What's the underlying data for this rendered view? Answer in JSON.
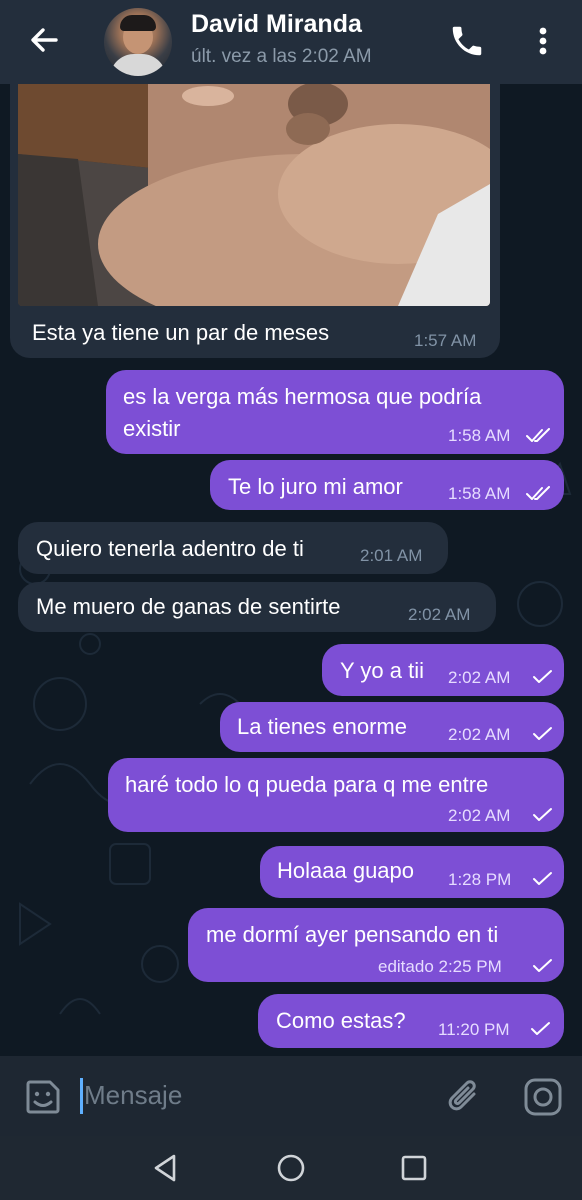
{
  "header": {
    "contact_name": "David Miranda",
    "last_seen": "últ. vez a las 2:02 AM",
    "icons": [
      "back-arrow-icon",
      "phone-icon",
      "more-vert-icon"
    ]
  },
  "messages": [
    {
      "direction": "in",
      "kind": "photo",
      "text": "Esta ya tiene un par de meses",
      "time": "1:57 AM"
    },
    {
      "direction": "out",
      "text": "es la verga más hermosa que podría",
      "text2": "existir",
      "time": "1:58 AM",
      "ticks": "read"
    },
    {
      "direction": "out",
      "text": "Te lo juro mi amor",
      "time": "1:58 AM",
      "ticks": "read"
    },
    {
      "direction": "in",
      "text": "Quiero tenerla adentro de ti",
      "time": "2:01 AM"
    },
    {
      "direction": "in",
      "text": "Me muero de ganas de sentirte",
      "time": "2:02 AM"
    },
    {
      "direction": "out",
      "text": "Y yo a tii",
      "time": "2:02 AM",
      "ticks": "sent"
    },
    {
      "direction": "out",
      "text": "La tienes enorme",
      "time": "2:02 AM",
      "ticks": "sent"
    },
    {
      "direction": "out",
      "text": "haré todo lo q pueda para q me entre",
      "time": "2:02 AM",
      "ticks": "sent"
    },
    {
      "direction": "out",
      "text": "Holaaa guapo",
      "time": "1:28 PM",
      "ticks": "sent"
    },
    {
      "direction": "out",
      "text": "me dormí ayer pensando en ti",
      "time": "editado 2:25 PM",
      "ticks": "sent"
    },
    {
      "direction": "out",
      "text": "Como estas?",
      "time": "11:20 PM",
      "ticks": "sent"
    }
  ],
  "composer": {
    "placeholder": "Mensaje",
    "icons": [
      "sticker-icon",
      "attach-icon",
      "camera-icon"
    ]
  },
  "system_nav": {
    "icons": [
      "nav-back-icon",
      "nav-home-icon",
      "nav-recents-icon"
    ]
  },
  "colors": {
    "header_bg": "#232e3c",
    "chat_bg": "#0f1923",
    "incoming_bubble": "#232e3c",
    "outgoing_bubble": "#7d4fd5"
  }
}
